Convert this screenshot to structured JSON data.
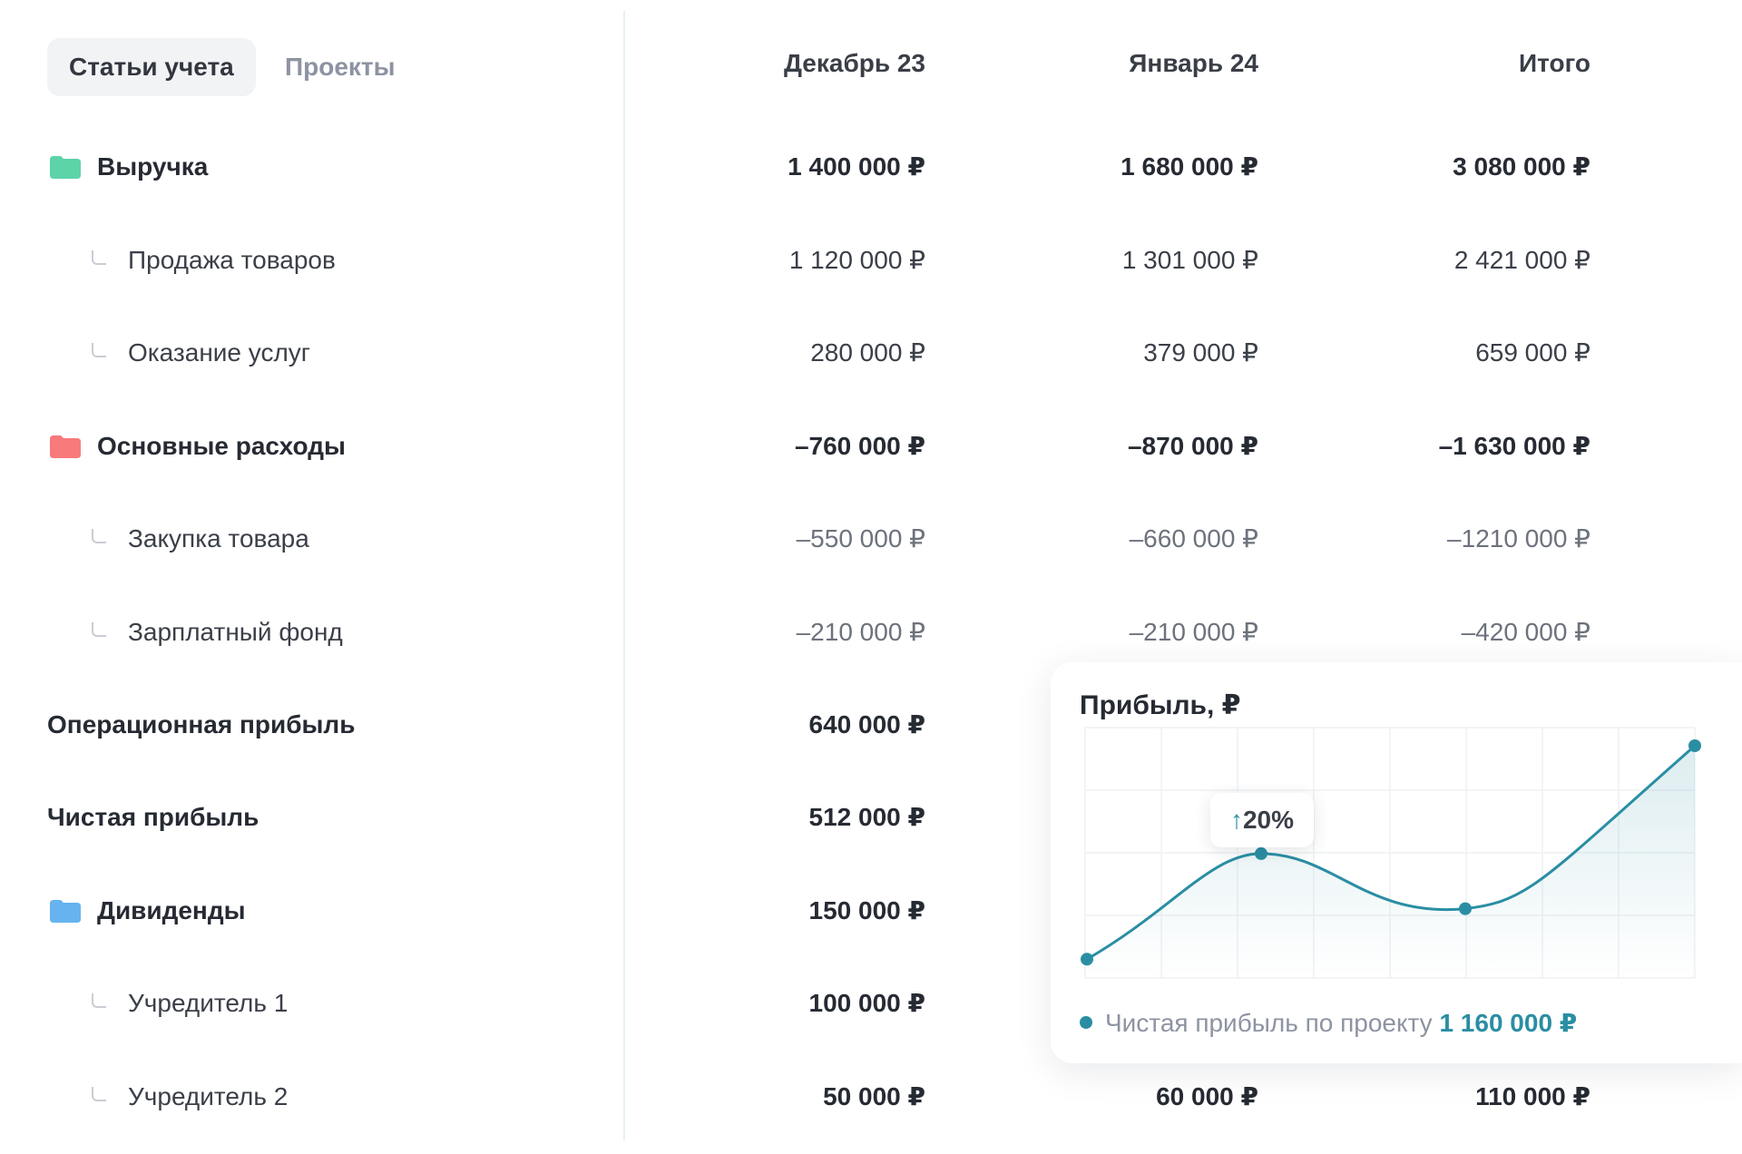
{
  "tabs": [
    {
      "label": "Статьи учета",
      "active": true
    },
    {
      "label": "Проекты",
      "active": false
    }
  ],
  "columns": [
    "Декабрь 23",
    "Январь 24",
    "Итого"
  ],
  "rows": [
    {
      "label": "Выручка",
      "values": [
        "1 400 000 ₽",
        "1 680 000 ₽",
        "3 080 000 ₽"
      ]
    },
    {
      "label": "Продажа товаров",
      "values": [
        "1 120 000 ₽",
        "1 301 000 ₽",
        "2 421 000 ₽"
      ]
    },
    {
      "label": "Оказание услуг",
      "values": [
        "280 000 ₽",
        "379 000 ₽",
        "659 000 ₽"
      ]
    },
    {
      "label": "Основные расходы",
      "values": [
        "–760 000 ₽",
        "–870 000 ₽",
        "–1 630 000 ₽"
      ]
    },
    {
      "label": "Закупка товара",
      "values": [
        "–550 000 ₽",
        "–660 000 ₽",
        "–1210 000 ₽"
      ]
    },
    {
      "label": "Зарплатный фонд",
      "values": [
        "–210 000 ₽",
        "–210 000 ₽",
        "–420 000 ₽"
      ]
    },
    {
      "label": "Операционная прибыль",
      "values": [
        "640 000 ₽"
      ]
    },
    {
      "label": "Чистая прибыль",
      "values": [
        "512 000 ₽"
      ]
    },
    {
      "label": "Дивиденды",
      "values": [
        "150 000 ₽"
      ]
    },
    {
      "label": "Учредитель 1",
      "values": [
        "100 000 ₽"
      ]
    },
    {
      "label": "Учредитель 2",
      "values": [
        "50 000 ₽",
        "60 000 ₽",
        "110 000 ₽"
      ]
    }
  ],
  "colors": {
    "revenue_folder": "#5dd3a8",
    "expenses_folder": "#f87a7a",
    "dividends_folder": "#66b3ef",
    "accent": "#2a8ea3"
  },
  "profit_card": {
    "title": "Прибыль, ₽",
    "badge_arrow": "↑",
    "badge": "20%",
    "legend_text": "Чистая прибыль по проекту",
    "legend_value": "1 160 000 ₽",
    "chart_data": {
      "type": "line",
      "grid": true,
      "points": [
        0.07,
        0.53,
        0.29,
        1.0
      ]
    }
  }
}
